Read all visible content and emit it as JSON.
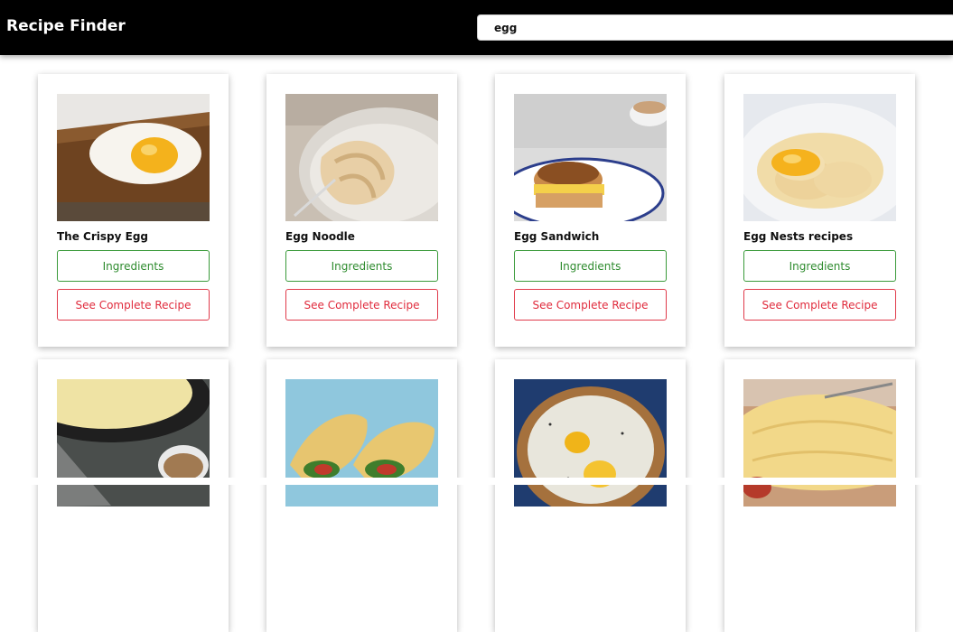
{
  "header": {
    "brand": "Recipe Finder",
    "search_value": "egg"
  },
  "recipes": [
    {
      "title": "The Crispy Egg",
      "ingredients_label": "Ingredients",
      "recipe_label": "See Complete Recipe"
    },
    {
      "title": "Egg Noodle",
      "ingredients_label": "Ingredients",
      "recipe_label": "See Complete Recipe"
    },
    {
      "title": "Egg Sandwich",
      "ingredients_label": "Ingredients",
      "recipe_label": "See Complete Recipe"
    },
    {
      "title": "Egg Nests recipes",
      "ingredients_label": "Ingredients",
      "recipe_label": "See Complete Recipe"
    },
    {
      "title": "",
      "ingredients_label": "",
      "recipe_label": ""
    },
    {
      "title": "",
      "ingredients_label": "",
      "recipe_label": ""
    },
    {
      "title": "",
      "ingredients_label": "",
      "recipe_label": ""
    },
    {
      "title": "",
      "ingredients_label": "",
      "recipe_label": ""
    }
  ],
  "colors": {
    "navbar": "#000000",
    "ingredients_accent": "#2e8b2e",
    "recipe_accent": "#e02b3c"
  }
}
